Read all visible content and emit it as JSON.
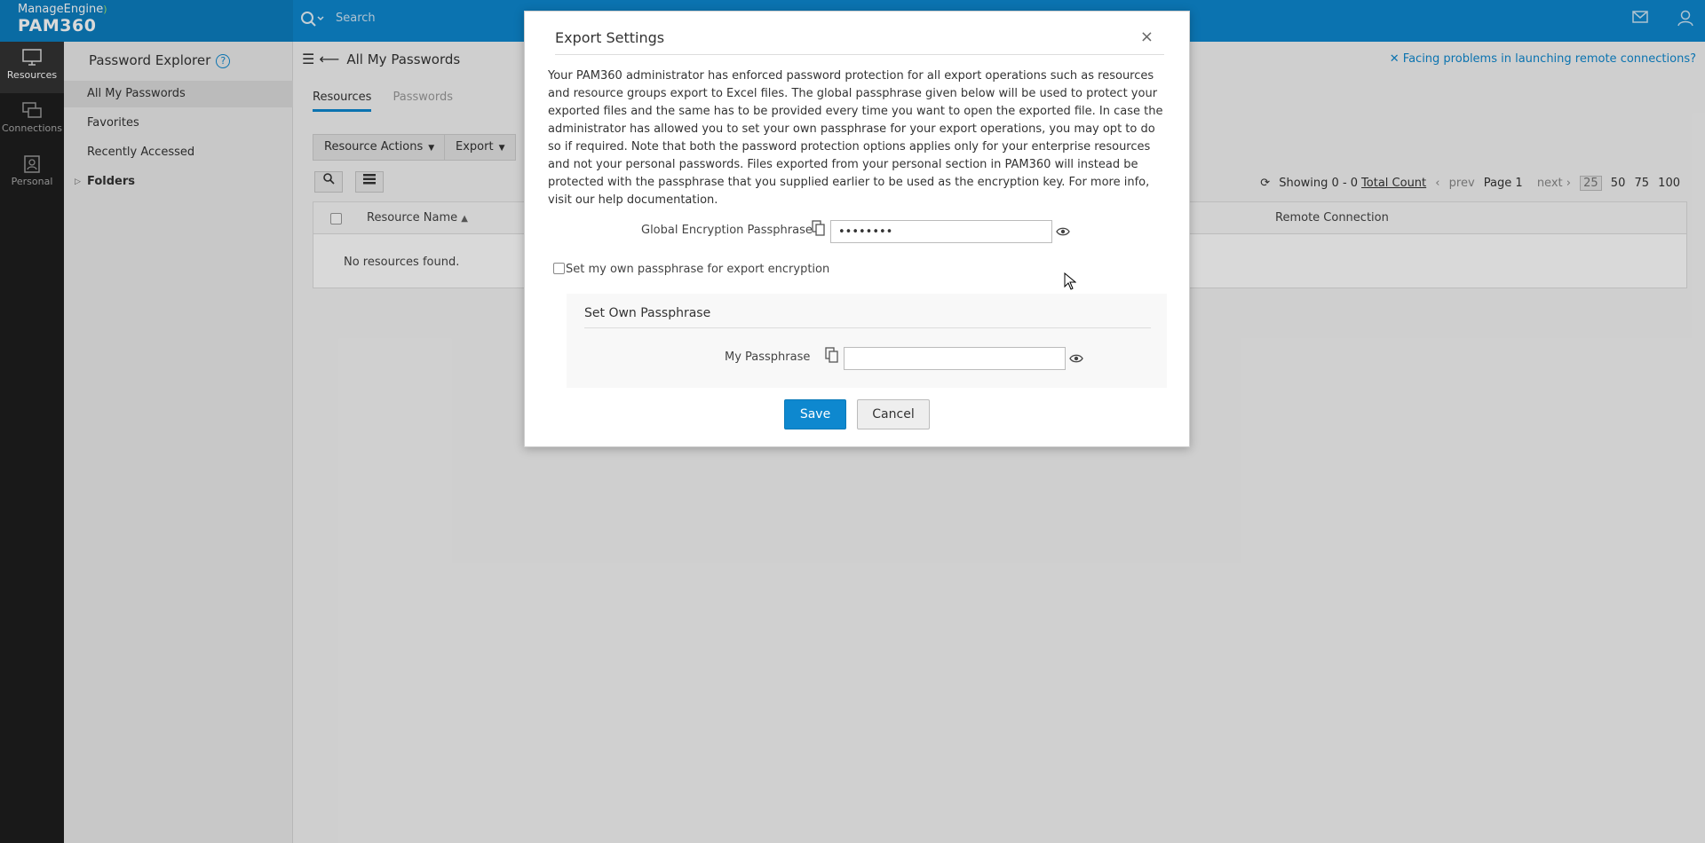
{
  "brand": {
    "vendor": "ManageEngine",
    "product": "PAM360"
  },
  "search": {
    "placeholder": "Search"
  },
  "rail": [
    {
      "label": "Resources",
      "icon": "monitor-icon",
      "active": true
    },
    {
      "label": "Connections",
      "icon": "connections-icon",
      "active": false
    },
    {
      "label": "Personal",
      "icon": "personal-icon",
      "active": false
    }
  ],
  "sidebar": {
    "title": "Password Explorer",
    "items": [
      {
        "label": "All My Passwords"
      },
      {
        "label": "Favorites"
      },
      {
        "label": "Recently Accessed"
      },
      {
        "label": "Folders"
      }
    ]
  },
  "main": {
    "breadcrumb": "All My Passwords",
    "help_link": "Facing problems in launching remote connections?",
    "tabs": [
      {
        "label": "Resources"
      },
      {
        "label": "Passwords"
      }
    ],
    "resource_actions": "Resource Actions",
    "export": "Export",
    "pager": {
      "showing": "Showing 0 - 0",
      "total": "Total Count",
      "prev": "prev",
      "page": "Page 1",
      "next": "next",
      "sizes": [
        "25",
        "50",
        "75",
        "100"
      ]
    },
    "table": {
      "col_resource_name": "Resource Name",
      "col_remote_connection": "Remote Connection",
      "empty": "No resources found."
    }
  },
  "modal": {
    "title": "Export Settings",
    "description": "Your PAM360 administrator has enforced password protection for all export operations such as resources and resource groups export to Excel files. The global passphrase given below will be used to protect your exported files and the same has to be provided every time you want to open the exported file. In case the administrator has allowed you to set your own passphrase for your export operations, you may opt to do so if required. Note that both the password protection options applies only for your enterprise resources and not your personal passwords. Files exported from your personal section in PAM360 will instead be protected with the passphrase that you supplied earlier to be used as the encryption key. For more info, visit our help documentation.",
    "global_label": "Global Encryption Passphrase",
    "global_value": "••••••••",
    "own_checkbox_label": "Set my own passphrase for export encryption",
    "own_title": "Set Own Passphrase",
    "my_passphrase_label": "My Passphrase",
    "my_passphrase_value": "",
    "save": "Save",
    "cancel": "Cancel",
    "close": "×"
  },
  "colors": {
    "accent": "#0e88cf",
    "rail": "#1e1e1e"
  }
}
